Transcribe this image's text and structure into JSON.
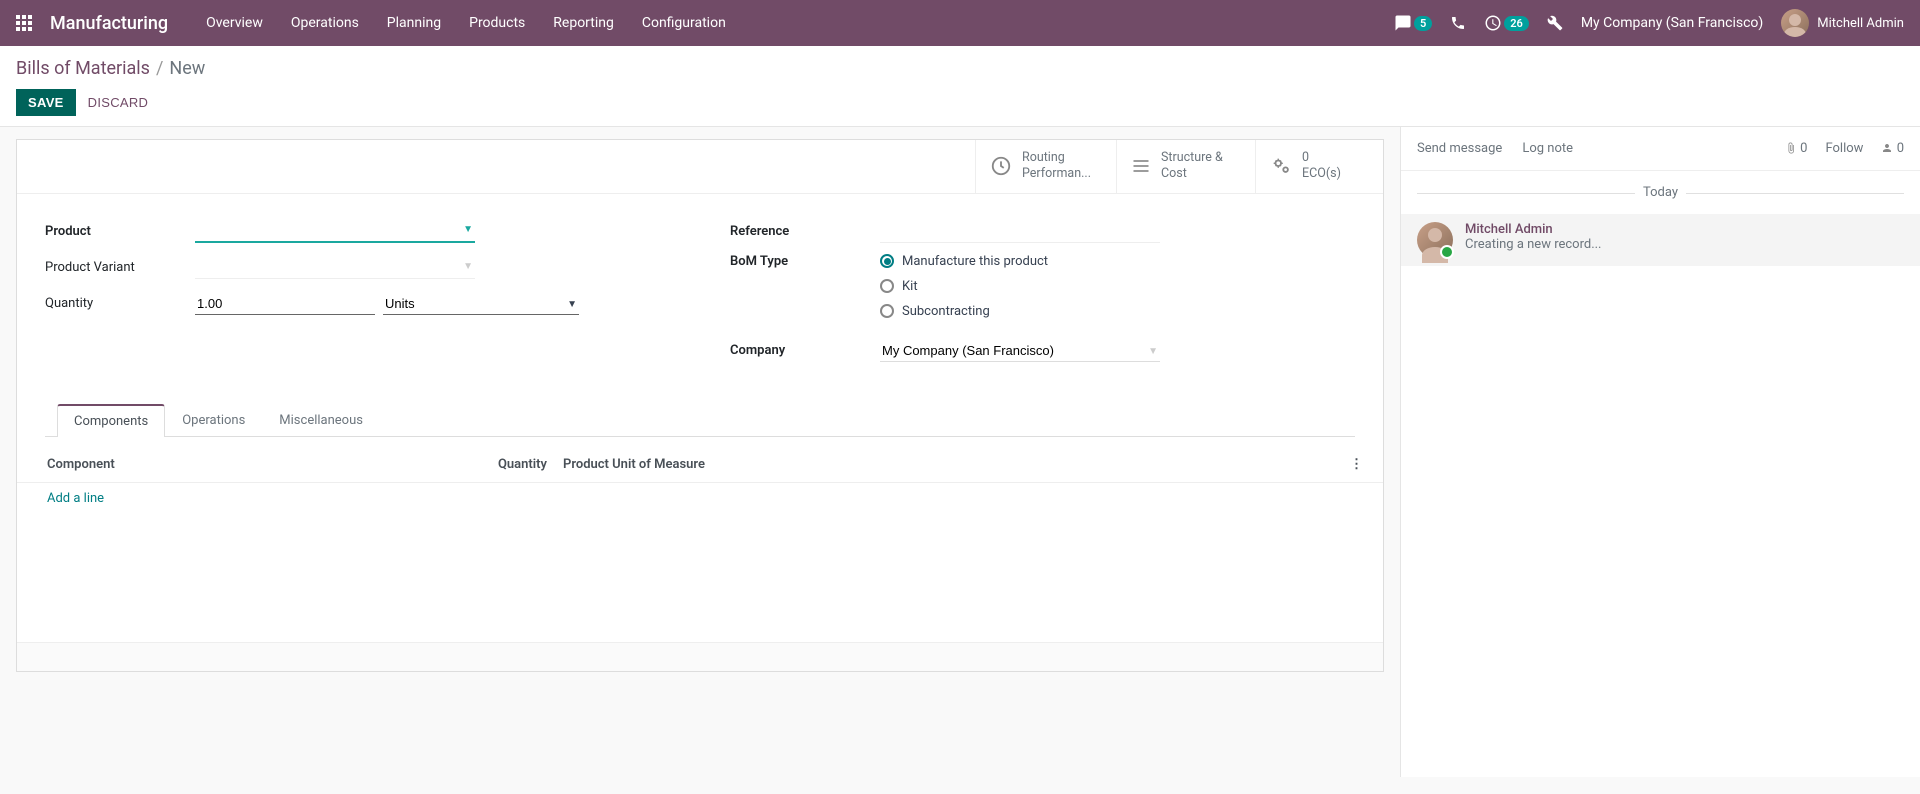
{
  "navbar": {
    "brand": "Manufacturing",
    "menu": [
      "Overview",
      "Operations",
      "Planning",
      "Products",
      "Reporting",
      "Configuration"
    ],
    "chat_badge": "5",
    "clock_badge": "26",
    "company": "My Company (San Francisco)",
    "user": "Mitchell Admin"
  },
  "breadcrumb": {
    "root": "Bills of Materials",
    "current": "New"
  },
  "buttons": {
    "save": "SAVE",
    "discard": "DISCARD"
  },
  "stat_buttons": {
    "routing": "Routing Performan...",
    "structure": "Structure & Cost",
    "eco_count": "0",
    "eco_label": "ECO(s)"
  },
  "form": {
    "product_label": "Product",
    "variant_label": "Product Variant",
    "quantity_label": "Quantity",
    "quantity_value": "1.00",
    "quantity_uom": "Units",
    "reference_label": "Reference",
    "bom_type_label": "BoM Type",
    "bom_type_options": {
      "manufacture": "Manufacture this product",
      "kit": "Kit",
      "subcontracting": "Subcontracting"
    },
    "company_label": "Company",
    "company_value": "My Company (San Francisco)"
  },
  "tabs": {
    "components": "Components",
    "operations": "Operations",
    "misc": "Miscellaneous"
  },
  "list": {
    "col_component": "Component",
    "col_quantity": "Quantity",
    "col_uom": "Product Unit of Measure",
    "add_line": "Add a line"
  },
  "chatter": {
    "send": "Send message",
    "log": "Log note",
    "attach_count": "0",
    "follow": "Follow",
    "followers": "0",
    "today": "Today",
    "author": "Mitchell Admin",
    "message": "Creating a new record..."
  }
}
